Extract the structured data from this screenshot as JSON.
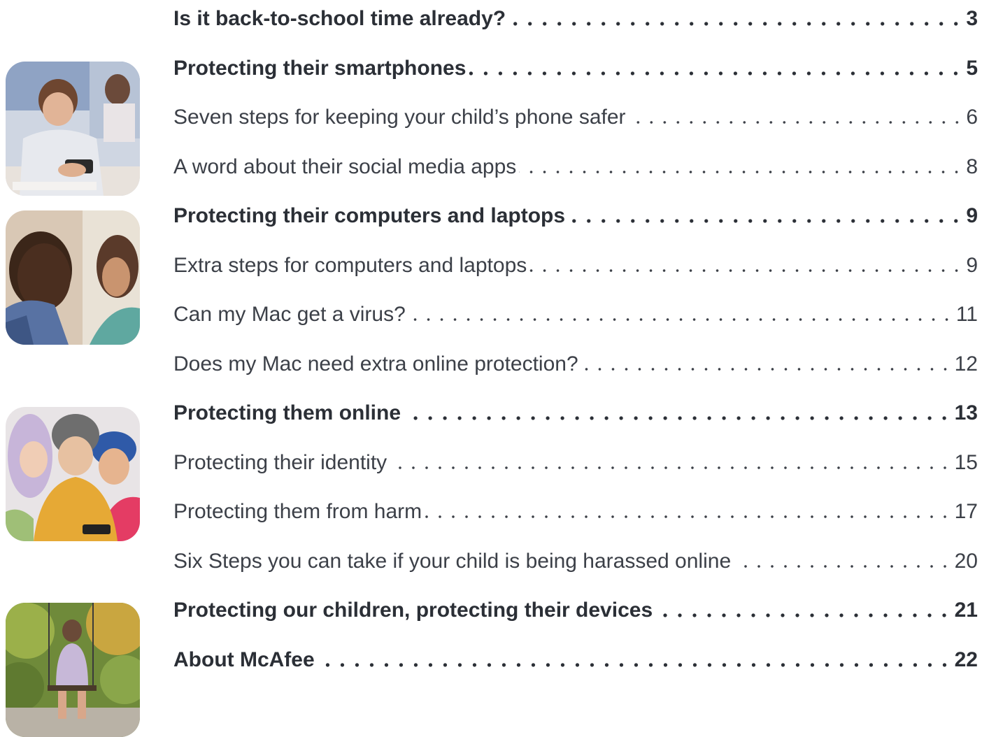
{
  "toc": {
    "entries": [
      {
        "title": "Is it back-to-school time already?",
        "page": "3",
        "style": "bold"
      },
      {
        "title": "Protecting their smartphones",
        "page": "5",
        "style": "bold"
      },
      {
        "title": "Seven steps for keeping your child’s phone safer",
        "page": "6",
        "style": "reg"
      },
      {
        "title": "A word about their social media apps",
        "page": "8",
        "style": "reg"
      },
      {
        "title": "Protecting their computers and laptops",
        "page": "9",
        "style": "bold"
      },
      {
        "title": "Extra steps for computers and laptops",
        "page": "9",
        "style": "reg"
      },
      {
        "title": "Can my Mac get a virus?",
        "page": "11",
        "style": "reg"
      },
      {
        "title": "Does my Mac need extra online protection?",
        "page": "12",
        "style": "reg"
      },
      {
        "title": "Protecting them online",
        "page": "13",
        "style": "bold"
      },
      {
        "title": "Protecting their identity",
        "page": "15",
        "style": "reg"
      },
      {
        "title": "Protecting them from harm",
        "page": "17",
        "style": "reg"
      },
      {
        "title": "Six Steps you can take if your child is being harassed online",
        "page": "20",
        "style": "reg"
      },
      {
        "title": "Protecting our children, protecting their devices",
        "page": "21",
        "style": "bold"
      },
      {
        "title": "About McAfee",
        "page": "22",
        "style": "bold"
      }
    ]
  }
}
